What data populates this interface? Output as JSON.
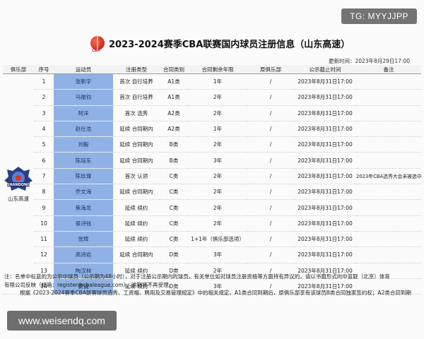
{
  "header": {
    "logo_text": "CBA",
    "title": "2023-2024赛季CBA联赛国内球员注册信息（山东高速）",
    "update_time": "更新时间：2023年8月29日17:00"
  },
  "club": {
    "name": "山东高速",
    "logo_text": "SHANDONG"
  },
  "columns": [
    "俱乐部",
    "序号",
    "运动员",
    "注册类型",
    "合同类别",
    "合同剩余年限",
    "原俱乐部",
    "公示截止时间",
    "备注"
  ],
  "rows": [
    {
      "no": "1",
      "name": "张新宇",
      "reg": "首次",
      "regsub": "自行培养",
      "cat": "A1类",
      "years": "1年",
      "orig": "/",
      "deadline": "2023年8月31日17:00",
      "note": ""
    },
    {
      "no": "2",
      "name": "马振钧",
      "reg": "首次",
      "regsub": "自行培养",
      "cat": "A1类",
      "years": "2年",
      "orig": "/",
      "deadline": "2023年8月31日17:00",
      "note": ""
    },
    {
      "no": "3",
      "name": "阿洋",
      "reg": "首次",
      "regsub": "选秀",
      "cat": "A2类",
      "years": "2年",
      "orig": "/",
      "deadline": "2023年8月31日17:00",
      "note": ""
    },
    {
      "no": "4",
      "name": "赵仕浩",
      "reg": "延续",
      "regsub": "合同期内",
      "cat": "A2类",
      "years": "1年",
      "orig": "/",
      "deadline": "2023年8月31日17:00",
      "note": ""
    },
    {
      "no": "5",
      "name": "刘毅",
      "reg": "延续",
      "regsub": "合同期内",
      "cat": "B类",
      "years": "2年",
      "orig": "/",
      "deadline": "2023年8月31日17:00",
      "note": ""
    },
    {
      "no": "6",
      "name": "陈培东",
      "reg": "延续",
      "regsub": "合同期内",
      "cat": "B类",
      "years": "3年",
      "orig": "/",
      "deadline": "2023年8月31日17:00",
      "note": ""
    },
    {
      "no": "7",
      "name": "陈玖璋",
      "reg": "首次",
      "regsub": "认领",
      "cat": "C类",
      "years": "2年",
      "orig": "/",
      "deadline": "2023年8月31日17:00",
      "note": "2023年CBA选秀大会未被选中球员"
    },
    {
      "no": "8",
      "name": "乔文海",
      "reg": "延续",
      "regsub": "合同期内",
      "cat": "C类",
      "years": "2年",
      "orig": "/",
      "deadline": "2023年8月31日17:00",
      "note": ""
    },
    {
      "no": "9",
      "name": "焦海龙",
      "reg": "延续",
      "regsub": "续约",
      "cat": "C类",
      "years": "2年",
      "orig": "/",
      "deadline": "2023年8月31日17:00",
      "note": ""
    },
    {
      "no": "10",
      "name": "侯诗铉",
      "reg": "延续",
      "regsub": "续约",
      "cat": "C类",
      "years": "2年",
      "orig": "/",
      "deadline": "2023年8月31日17:00",
      "note": ""
    },
    {
      "no": "11",
      "name": "张辉",
      "reg": "延续",
      "regsub": "续约",
      "cat": "C类",
      "years": "1+1年（俱乐部选项）",
      "orig": "/",
      "deadline": "2023年8月31日17:00",
      "note": ""
    },
    {
      "no": "12",
      "name": "高诗岩",
      "reg": "延续",
      "regsub": "合同期内",
      "cat": "D类",
      "years": "3年",
      "orig": "/",
      "deadline": "2023年8月31日17:00",
      "note": ""
    },
    {
      "no": "13",
      "name": "陶汉林",
      "reg": "延续",
      "regsub": "续约",
      "cat": "D类",
      "years": "2年",
      "orig": "/",
      "deadline": "2023年8月31日17:00",
      "note": ""
    },
    {
      "no": "14",
      "name": "贾诚",
      "reg": "延续",
      "regsub": "续约",
      "cat": "D类",
      "years": "3年",
      "orig": "/",
      "deadline": "2023年8月31日17:00",
      "note": ""
    }
  ],
  "notes": [
    "注：名单中标蓝的为公示中球员（公示期为48小时），对于注册公示期内的球员，有关单位如对球员注册资格等方面持有异议的，请以书面形式向中篮联（北京）体育",
    "有限公司反映（邮箱：register@cbaleague.com），逾期将不再受理。",
    "根据《2023-2024赛季CBA联赛球员选秀、工资帽、聘用及交易管理规定》中的相关规定，A1类合同到期后，原俱乐部享有该球员B类合同独家签约权；A2类合同到期"
  ],
  "watermarks": {
    "top": "TG: MYYJJPP",
    "bottom": "www.weisendq.com"
  },
  "colors": {
    "highlight": "#8fb2e6",
    "logo_red": "#d5352a"
  }
}
